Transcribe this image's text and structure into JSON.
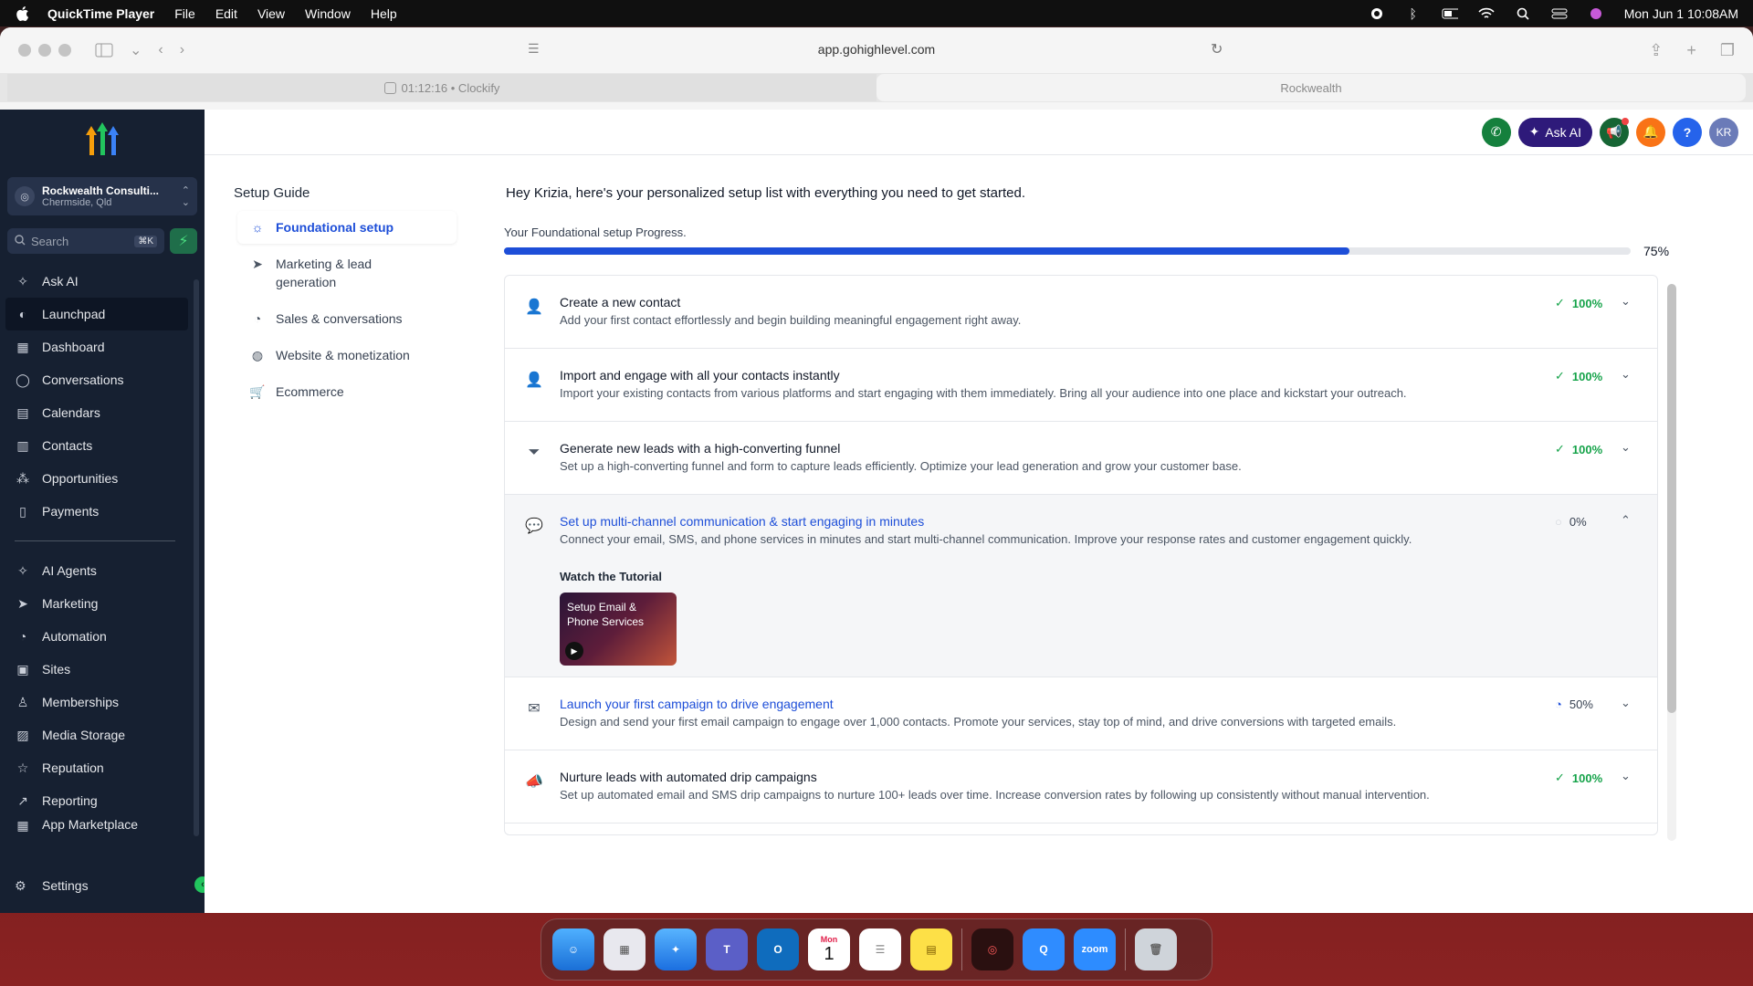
{
  "menubar": {
    "app_name": "QuickTime Player",
    "items": [
      "File",
      "Edit",
      "View",
      "Window",
      "Help"
    ],
    "clock": "Mon Jun 1  10:08AM"
  },
  "browser": {
    "url": "app.gohighlevel.com",
    "tabs": [
      {
        "label": "01:12:16 • Clockify",
        "active": false
      },
      {
        "label": "Rockwealth",
        "active": true
      }
    ]
  },
  "sidebar": {
    "account_name": "Rockwealth Consulti...",
    "account_location": "Chermside, Qld",
    "search_placeholder": "Search",
    "search_shortcut": "⌘K",
    "items_top": [
      {
        "label": "Ask AI",
        "icon": "sparkle-icon",
        "active": false
      },
      {
        "label": "Launchpad",
        "icon": "rocket-icon",
        "active": true
      },
      {
        "label": "Dashboard",
        "icon": "grid-icon",
        "active": false
      },
      {
        "label": "Conversations",
        "icon": "chat-icon",
        "active": false
      },
      {
        "label": "Calendars",
        "icon": "calendar-icon",
        "active": false
      },
      {
        "label": "Contacts",
        "icon": "contacts-icon",
        "active": false
      },
      {
        "label": "Opportunities",
        "icon": "funnel-grid-icon",
        "active": false
      },
      {
        "label": "Payments",
        "icon": "receipt-icon",
        "active": false
      }
    ],
    "items_bottom": [
      {
        "label": "AI Agents",
        "icon": "sparkle-icon"
      },
      {
        "label": "Marketing",
        "icon": "send-icon"
      },
      {
        "label": "Automation",
        "icon": "automation-icon"
      },
      {
        "label": "Sites",
        "icon": "sites-icon"
      },
      {
        "label": "Memberships",
        "icon": "membership-icon"
      },
      {
        "label": "Media Storage",
        "icon": "image-icon"
      },
      {
        "label": "Reputation",
        "icon": "star-icon"
      },
      {
        "label": "Reporting",
        "icon": "trend-icon"
      },
      {
        "label": "App Marketplace",
        "icon": "apps-icon"
      }
    ],
    "settings_label": "Settings"
  },
  "topbar": {
    "ask_ai_label": "Ask AI",
    "avatar_initials": "KR",
    "help_label": "?"
  },
  "guide": {
    "title": "Setup Guide",
    "items": [
      {
        "label": "Foundational setup",
        "icon": "sun-icon",
        "active": true
      },
      {
        "label": "Marketing & lead generation",
        "icon": "send-icon",
        "active": false
      },
      {
        "label": "Sales & conversations",
        "icon": "sales-icon",
        "active": false
      },
      {
        "label": "Website & monetization",
        "icon": "globe-icon",
        "active": false
      },
      {
        "label": "Ecommerce",
        "icon": "cart-icon",
        "active": false
      }
    ]
  },
  "main": {
    "greeting": "Hey Krizia, here's your personalized setup list with everything you need to get started.",
    "progress_label": "Your Foundational setup Progress.",
    "progress_value": 0.75,
    "progress_text": "75%",
    "tasks": [
      {
        "title": "Create a new contact",
        "desc": "Add your first contact effortlessly and begin building meaningful engagement right away.",
        "status": "100%",
        "done": true,
        "icon": "user-plus-icon"
      },
      {
        "title": "Import and engage with all your contacts instantly",
        "desc": "Import your existing contacts from various platforms and start engaging with them immediately. Bring all your audience into one place and kickstart your outreach.",
        "status": "100%",
        "done": true,
        "icon": "user-plus-icon"
      },
      {
        "title": "Generate new leads with a high-converting funnel",
        "desc": "Set up a high-converting funnel and form to capture leads efficiently. Optimize your lead generation and grow your customer base.",
        "status": "100%",
        "done": true,
        "icon": "filter-icon"
      },
      {
        "title": "Set up multi-channel communication & start engaging in minutes",
        "desc": "Connect your email, SMS, and phone services in minutes and start multi-channel communication. Improve your response rates and customer engagement quickly.",
        "status": "0%",
        "done": false,
        "icon": "chat-icon",
        "expanded": true,
        "tutorial_label": "Watch the Tutorial",
        "tutorial_title": "Setup Email & Phone Services"
      },
      {
        "title": "Launch your first campaign to drive engagement",
        "desc": "Design and send your first email campaign to engage over 1,000 contacts. Promote your services, stay top of mind, and drive conversions with targeted emails.",
        "status": "50%",
        "done": false,
        "icon": "mail-icon"
      },
      {
        "title": "Nurture leads with automated drip campaigns",
        "desc": "Set up automated email and SMS drip campaigns to nurture 100+ leads over time. Increase conversion rates by following up consistently without manual intervention.",
        "status": "100%",
        "done": true,
        "icon": "megaphone-icon"
      }
    ]
  },
  "dock": {
    "calendar_day": "1",
    "calendar_month": "Mon",
    "zoom_label": "zoom"
  }
}
